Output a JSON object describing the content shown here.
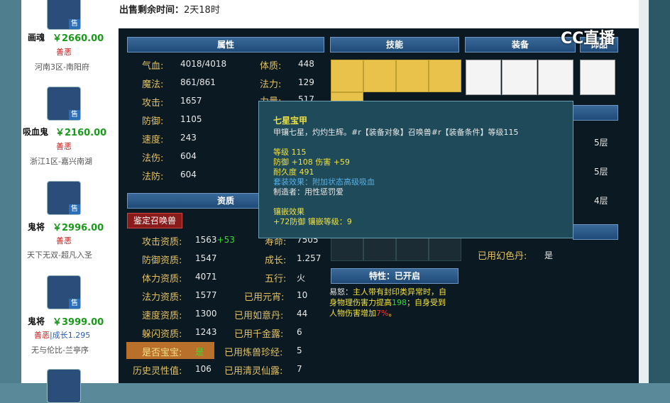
{
  "sale": {
    "label": "出售剩余时间：",
    "value": "2天18时"
  },
  "watermark": "CC直播",
  "listings": [
    {
      "name": "画魂",
      "price": "￥2660.00",
      "type": "善恶",
      "extra": "",
      "loc": "河南3区-南阳府",
      "tag": "售"
    },
    {
      "name": "吸血鬼",
      "price": "￥2160.00",
      "type": "善恶",
      "extra": "",
      "loc": "浙江1区-嘉兴南湖",
      "tag": "售"
    },
    {
      "name": "鬼将",
      "price": "￥2996.00",
      "type": "善恶",
      "extra": "",
      "loc": "天下无双-超凡入圣",
      "tag": "售"
    },
    {
      "name": "鬼将",
      "price": "￥3999.00",
      "type": "善恶",
      "extra": "|成长1.295",
      "loc": "无与伦比-兰亭序",
      "tag": "售"
    }
  ],
  "headers": {
    "attrs": "属性",
    "skills": "技能",
    "equip": "装备",
    "ornament": "饰品",
    "aptitude": "资质",
    "trait": "特性：已开启"
  },
  "attrs": [
    {
      "label": "气血:",
      "value": "4018/4018"
    },
    {
      "label": "魔法:",
      "value": "861/861"
    },
    {
      "label": "攻击:",
      "value": "1657"
    },
    {
      "label": "防御:",
      "value": "1105"
    },
    {
      "label": "速度:",
      "value": "243"
    },
    {
      "label": "法伤:",
      "value": "604"
    },
    {
      "label": "法防:",
      "value": "604"
    }
  ],
  "attrs2": [
    {
      "label": "体质:",
      "value": "448"
    },
    {
      "label": "法力:",
      "value": "129"
    },
    {
      "label": "力量:",
      "value": "517"
    }
  ],
  "identify_button": "鉴定召唤兽",
  "aptitude": [
    {
      "label": "攻击资质:",
      "value": "1563",
      "bonus": "+53"
    },
    {
      "label": "防御资质:",
      "value": "1547",
      "bonus": ""
    },
    {
      "label": "体力资质:",
      "value": "4071",
      "bonus": ""
    },
    {
      "label": "法力资质:",
      "value": "1577",
      "bonus": ""
    },
    {
      "label": "速度资质:",
      "value": "1300",
      "bonus": ""
    },
    {
      "label": "躲闪资质:",
      "value": "1243",
      "bonus": ""
    }
  ],
  "is_baby": {
    "label": "是否宝宝:",
    "value": "是"
  },
  "spirit": {
    "label": "历史灵性值:",
    "value": "106"
  },
  "aptitude2": [
    {
      "label": "寿命:",
      "value": "7505"
    },
    {
      "label": "成长:",
      "value": "1.257"
    },
    {
      "label": "五行:",
      "value": "火"
    },
    {
      "label": "已用元宵:",
      "value": "10"
    },
    {
      "label": "已用如意丹:",
      "value": "44"
    },
    {
      "label": "已用千金露:",
      "value": "6"
    },
    {
      "label": "已用炼兽珍经:",
      "value": "5"
    },
    {
      "label": "已用清灵仙露:",
      "value": "7"
    }
  ],
  "used_color": {
    "label": "已用幻色丹:",
    "value": "是"
  },
  "layers": [
    "5层",
    "5层",
    "4层"
  ],
  "trait_text": {
    "name": "易怒：",
    "body1": "主人带有封印类异常时，自",
    "body2": "身物理伤害力提高",
    "num1": "198",
    "body3": "；自身受到",
    "body4": "人物伤害增加",
    "num2": "7%",
    "end": "。"
  },
  "tooltip": {
    "title": "七星宝甲",
    "desc": "甲镶七星，灼灼生辉。#r【装备对象】召唤兽#r【装备条件】等级115",
    "level": "等级 115",
    "stats": "防御 +108 伤害 +59",
    "durability": "耐久度 491",
    "set_effect": "套装效果：附加状态高级吸血",
    "maker": "制造者：用性惩罚爱",
    "inlay_title": "镶嵌效果",
    "inlay": "+72防御 镶嵌等级：9"
  }
}
